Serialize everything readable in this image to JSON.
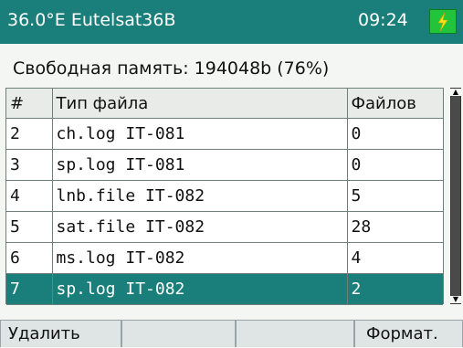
{
  "header": {
    "satellite": "36.0°E Eutelsat36B",
    "time": "09:24",
    "battery_icon": "battery-charging-icon"
  },
  "free_memory": "Свободная память: 194048b (76%)",
  "table": {
    "columns": [
      "#",
      "Тип файла",
      "Файлов"
    ],
    "rows": [
      {
        "num": "2",
        "type": "ch.log IT-081",
        "count": "0",
        "selected": false
      },
      {
        "num": "3",
        "type": "sp.log IT-081",
        "count": "0",
        "selected": false
      },
      {
        "num": "4",
        "type": "lnb.file IT-082",
        "count": "5",
        "selected": false
      },
      {
        "num": "5",
        "type": "sat.file IT-082",
        "count": "28",
        "selected": false
      },
      {
        "num": "6",
        "type": "ms.log IT-082",
        "count": "4",
        "selected": false
      },
      {
        "num": "7",
        "type": "sp.log IT-082",
        "count": "2",
        "selected": true
      }
    ]
  },
  "softkeys": [
    "Удалить",
    "",
    "",
    "Формат."
  ],
  "colors": {
    "accent": "#1a7f7a",
    "battery": "#21c43a",
    "bolt": "#f2e21a"
  }
}
